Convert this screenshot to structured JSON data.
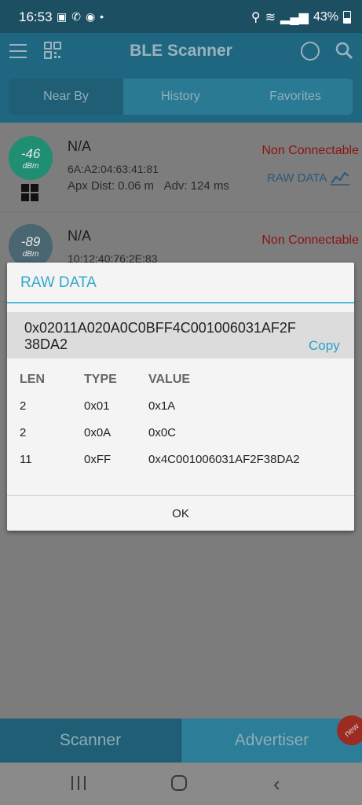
{
  "status_bar": {
    "time": "16:53",
    "battery": "43%"
  },
  "app_bar": {
    "title": "BLE Scanner"
  },
  "tabs": [
    {
      "label": "Near By",
      "active": true
    },
    {
      "label": "History",
      "active": false
    },
    {
      "label": "Favorites",
      "active": false
    }
  ],
  "devices": [
    {
      "rssi": "-46",
      "rssi_unit": "dBm",
      "name": "N/A",
      "mac": "6A:A2:04:63:41:81",
      "distance": "Apx Dist: 0.06 m",
      "adv": "Adv: 124 ms",
      "connectable": "Non Connectable",
      "raw_label": "RAW DATA",
      "rssi_color": "#1f8e72"
    },
    {
      "rssi": "-89",
      "rssi_unit": "dBm",
      "name": "N/A",
      "mac": "10:12:40:76:2E:83",
      "connectable": "Non Connectable",
      "rssi_color": "#4a6671"
    }
  ],
  "dialog": {
    "title": "RAW DATA",
    "raw_value": "0x02011A020A0C0BFF4C001006031AF2F38DA2",
    "copy_label": "Copy",
    "headers": [
      "LEN",
      "TYPE",
      "VALUE"
    ],
    "rows": [
      {
        "len": "2",
        "type": "0x01",
        "value": "0x1A"
      },
      {
        "len": "2",
        "type": "0x0A",
        "value": "0x0C"
      },
      {
        "len": "11",
        "type": "0xFF",
        "value": "0x4C001006031AF2F38DA2"
      }
    ],
    "ok_label": "OK"
  },
  "bottom_tabs": [
    {
      "label": "Scanner",
      "active": true
    },
    {
      "label": "Advertiser",
      "active": false
    }
  ],
  "new_badge": "new",
  "colors": {
    "accent": "#32a8cc",
    "toolbar": "#1f6781",
    "error": "#8b1313"
  }
}
